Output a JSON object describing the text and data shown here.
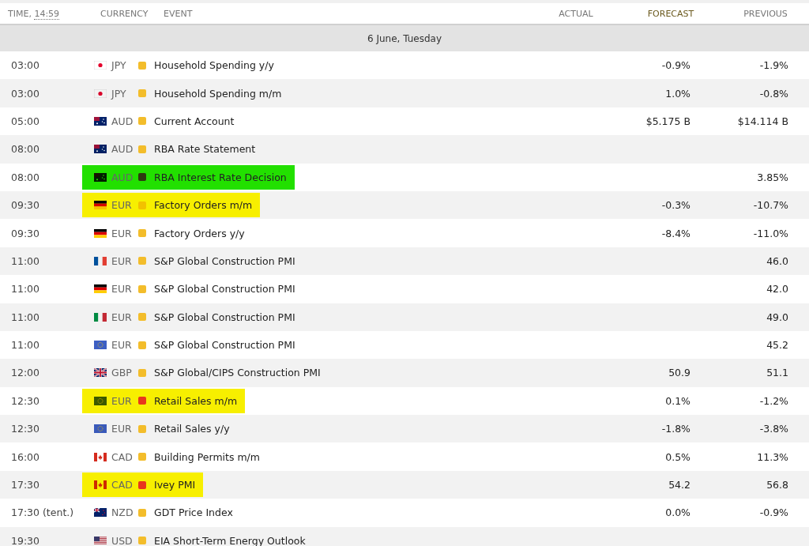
{
  "header": {
    "time_label": "TIME,",
    "clock": "14:59",
    "currency": "CURRENCY",
    "event": "EVENT",
    "actual": "ACTUAL",
    "forecast": "FORECAST",
    "previous": "PREVIOUS"
  },
  "date": "6 June, Tuesday",
  "rows": [
    {
      "time": "03:00",
      "flag": {
        "kind": "japan"
      },
      "currency": "JPY",
      "color": "#f3bd2b",
      "event": "Household Spending y/y",
      "forecast": "-0.9%",
      "previous": "-1.9%"
    },
    {
      "time": "03:00",
      "flag": {
        "kind": "japan"
      },
      "currency": "JPY",
      "color": "#f3bd2b",
      "event": "Household Spending m/m",
      "forecast": "1.0%",
      "previous": "-0.8%"
    },
    {
      "time": "05:00",
      "flag": {
        "kind": "australia"
      },
      "currency": "AUD",
      "color": "#f3bd2b",
      "event": "Current Account",
      "forecast": "$5.175 B",
      "previous": "$14.114 B"
    },
    {
      "time": "08:00",
      "flag": {
        "kind": "australia"
      },
      "currency": "AUD",
      "color": "#f3bd2b",
      "event": "RBA Rate Statement"
    },
    {
      "time": "08:00",
      "flag": {
        "kind": "australia"
      },
      "currency": "AUD",
      "color": "#2e3a10",
      "highlight": {
        "color": "#22e000"
      },
      "event": "RBA Interest Rate Decision",
      "previous": "3.85%"
    },
    {
      "time": "09:30",
      "flag": {
        "kind": "germany"
      },
      "currency": "EUR",
      "color": "#f2c100",
      "highlight": {
        "color": "#f7ef00"
      },
      "event": "Factory Orders m/m",
      "forecast": "-0.3%",
      "previous": "-10.7%"
    },
    {
      "time": "09:30",
      "flag": {
        "kind": "germany"
      },
      "currency": "EUR",
      "color": "#f3bd2b",
      "event": "Factory Orders y/y",
      "forecast": "-8.4%",
      "previous": "-11.0%"
    },
    {
      "time": "11:00",
      "flag": {
        "kind": "france"
      },
      "currency": "EUR",
      "color": "#f3bd2b",
      "event": "S&P Global Construction PMI",
      "previous": "46.0"
    },
    {
      "time": "11:00",
      "flag": {
        "kind": "germany"
      },
      "currency": "EUR",
      "color": "#f3bd2b",
      "event": "S&P Global Construction PMI",
      "previous": "42.0"
    },
    {
      "time": "11:00",
      "flag": {
        "kind": "italy"
      },
      "currency": "EUR",
      "color": "#f3bd2b",
      "event": "S&P Global Construction PMI",
      "previous": "49.0"
    },
    {
      "time": "11:00",
      "flag": {
        "kind": "eu"
      },
      "currency": "EUR",
      "color": "#f3bd2b",
      "event": "S&P Global Construction PMI",
      "previous": "45.2"
    },
    {
      "time": "12:00",
      "flag": {
        "kind": "uk"
      },
      "currency": "GBP",
      "color": "#f3bd2b",
      "event": "S&P Global/CIPS Construction PMI",
      "forecast": "50.9",
      "previous": "51.1"
    },
    {
      "time": "12:30",
      "flag": {
        "kind": "eu"
      },
      "currency": "EUR",
      "color": "#e8361d",
      "highlight": {
        "color": "#f7ef00"
      },
      "event": "Retail Sales m/m",
      "forecast": "0.1%",
      "previous": "-1.2%"
    },
    {
      "time": "12:30",
      "flag": {
        "kind": "eu"
      },
      "currency": "EUR",
      "color": "#f3bd2b",
      "event": "Retail Sales y/y",
      "forecast": "-1.8%",
      "previous": "-3.8%"
    },
    {
      "time": "16:00",
      "flag": {
        "kind": "canada"
      },
      "currency": "CAD",
      "color": "#f3bd2b",
      "event": "Building Permits m/m",
      "forecast": "0.5%",
      "previous": "11.3%"
    },
    {
      "time": "17:30",
      "flag": {
        "kind": "canada"
      },
      "currency": "CAD",
      "color": "#e8361d",
      "highlight": {
        "color": "#f7ef00"
      },
      "event": "Ivey PMI",
      "forecast": "54.2",
      "previous": "56.8"
    },
    {
      "time": "17:30 (tent.)",
      "flag": {
        "kind": "new_zealand"
      },
      "currency": "NZD",
      "color": "#f3bd2b",
      "event": "GDT Price Index",
      "forecast": "0.0%",
      "previous": "-0.9%"
    },
    {
      "time": "19:30",
      "flag": {
        "kind": "usa"
      },
      "currency": "USD",
      "color": "#f3bd2b",
      "event": "EIA Short-Term Energy Outlook"
    }
  ]
}
